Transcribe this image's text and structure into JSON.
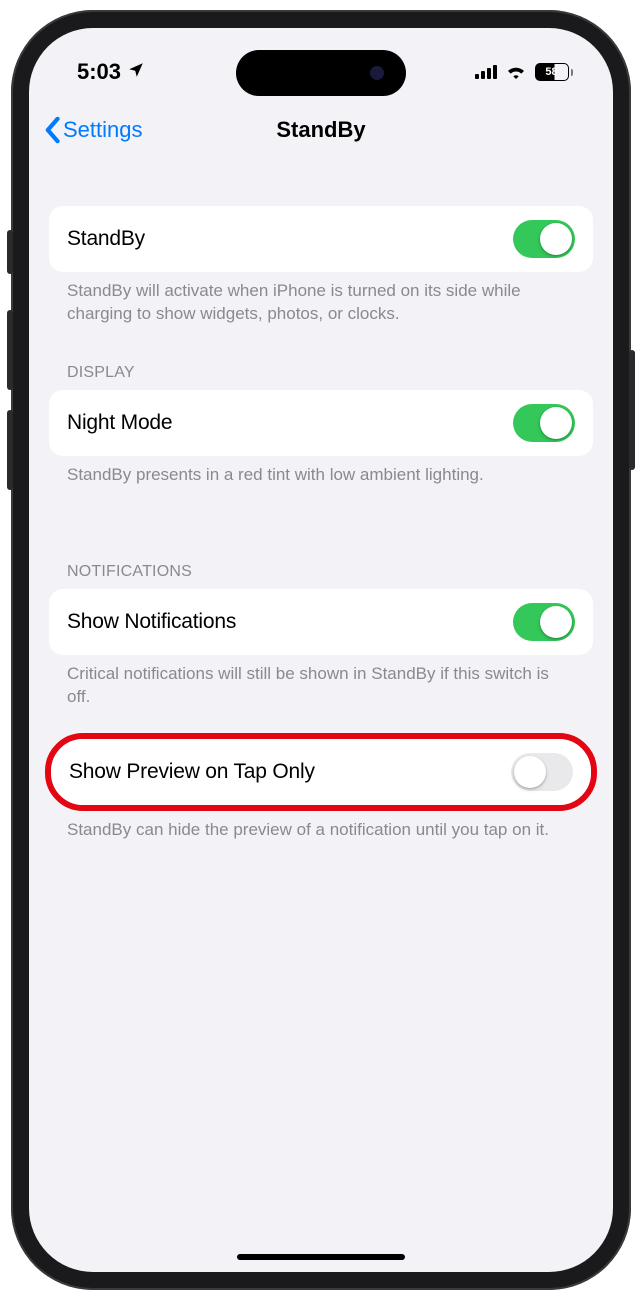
{
  "status": {
    "time": "5:03",
    "battery": "58"
  },
  "nav": {
    "back": "Settings",
    "title": "StandBy"
  },
  "groups": {
    "main": {
      "standby_label": "StandBy",
      "standby_footer": "StandBy will activate when iPhone is turned on its side while charging to show widgets, photos, or clocks."
    },
    "display": {
      "header": "DISPLAY",
      "night_mode_label": "Night Mode",
      "night_mode_footer": "StandBy presents in a red tint with low ambient lighting."
    },
    "notifications": {
      "header": "NOTIFICATIONS",
      "show_notifications_label": "Show Notifications",
      "show_notifications_footer": "Critical notifications will still be shown in StandBy if this switch is off.",
      "preview_label": "Show Preview on Tap Only",
      "preview_footer": "StandBy can hide the preview of a notification until you tap on it."
    }
  }
}
